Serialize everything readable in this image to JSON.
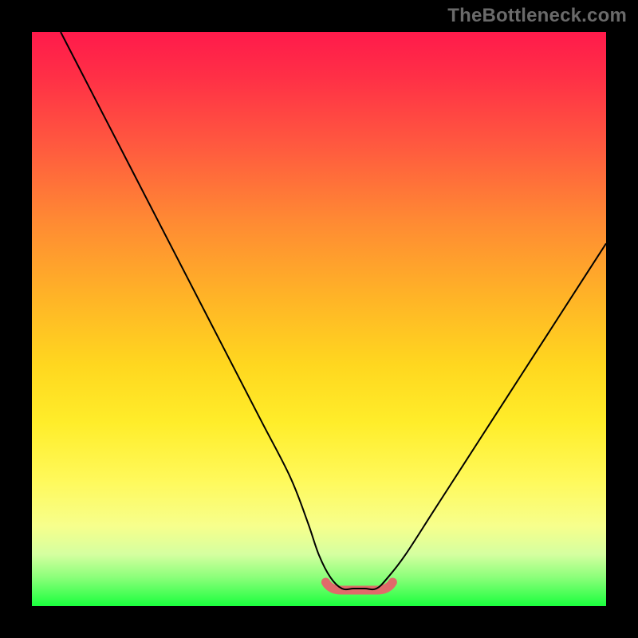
{
  "watermark": "TheBottleneck.com",
  "colors": {
    "frame_bg": "#000000",
    "gradient_top": "#ff1a4b",
    "gradient_bottom": "#1aff3d",
    "curve_stroke": "#000000",
    "bottom_highlight": "#e06a6a",
    "watermark_text": "#6a6a6a"
  },
  "chart_data": {
    "type": "line",
    "title": "",
    "xlabel": "",
    "ylabel": "",
    "xlim": [
      0,
      100
    ],
    "ylim": [
      0,
      100
    ],
    "grid": false,
    "legend": false,
    "legend_position": "none",
    "series": [
      {
        "name": "bottleneck-curve",
        "x": [
          5,
          10,
          15,
          20,
          25,
          30,
          35,
          40,
          45,
          48,
          50,
          52,
          54,
          56,
          58,
          60,
          62,
          65,
          70,
          75,
          80,
          85,
          90,
          95,
          100
        ],
        "values": [
          100,
          90,
          80,
          70,
          60,
          50,
          40,
          30,
          20,
          12,
          6,
          2,
          0,
          0,
          0,
          0,
          2,
          6,
          14,
          22,
          30,
          38,
          46,
          54,
          62
        ]
      }
    ],
    "annotations": [
      {
        "name": "optimal-range-highlight",
        "x_range": [
          52,
          62
        ],
        "y": 0,
        "color": "#e06a6a"
      }
    ]
  }
}
